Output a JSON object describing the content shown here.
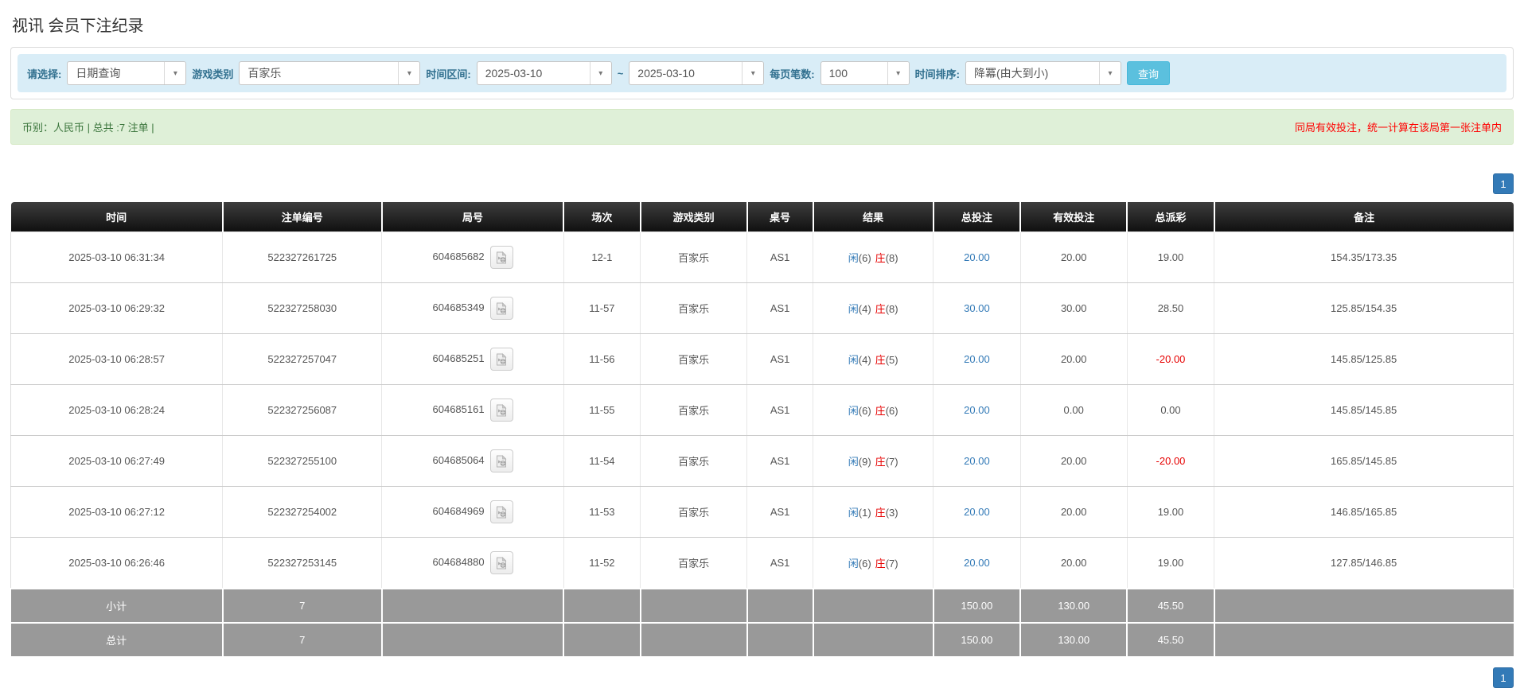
{
  "page": {
    "title": "视讯 会员下注纪录"
  },
  "filters": {
    "select_label": "请选择:",
    "query_type_value": "日期查询",
    "game_type_label": "游戏类别",
    "game_type_value": "百家乐",
    "date_range_label": "时间区间:",
    "date_from": "2025-03-10",
    "range_separator": "~",
    "date_to": "2025-03-10",
    "page_size_label": "每页笔数:",
    "page_size_value": "100",
    "sort_label": "时间排序:",
    "sort_value": "降冪(由大到小)",
    "search_button": "查询"
  },
  "summary": {
    "left_text": "币别：人民币 | 总共 :7 注单 |",
    "notice": "同局有效投注，统一计算在该局第一张注单内"
  },
  "pagination": {
    "active_page": "1"
  },
  "icons": {
    "dropdown_arrow": "▾",
    "video_replay_icon": "film-document-icon"
  },
  "colors": {
    "filter_bar_bg": "#d9edf7",
    "filter_label": "#31708f",
    "search_button": "#5bc0de",
    "summary_bg": "#dff0d8",
    "summary_text": "#3c763d",
    "notice_red": "#ff0000",
    "header_bg": "#1b1b1b",
    "footer_bg": "#999999",
    "link_blue": "#337ab7",
    "player_blue": "#337ab7",
    "banker_red": "#e60000",
    "negative_red": "#e60000",
    "pagination_active": "#337ab7"
  },
  "table": {
    "columns": [
      "时间",
      "注单编号",
      "局号",
      "场次",
      "游戏类别",
      "桌号",
      "结果",
      "总投注",
      "有效投注",
      "总派彩",
      "备注"
    ],
    "rows": [
      {
        "time": "2025-03-10 06:31:34",
        "bet_id": "522327261725",
        "round_id": "604685682",
        "session": "12-1",
        "game": "百家乐",
        "table_no": "AS1",
        "player": "闲",
        "player_score": "(6)",
        "banker": "庄",
        "banker_score": "(8)",
        "total_bet": "20.00",
        "valid_bet": "20.00",
        "payout": "19.00",
        "note": "154.35/173.35"
      },
      {
        "time": "2025-03-10 06:29:32",
        "bet_id": "522327258030",
        "round_id": "604685349",
        "session": "11-57",
        "game": "百家乐",
        "table_no": "AS1",
        "player": "闲",
        "player_score": "(4)",
        "banker": "庄",
        "banker_score": "(8)",
        "total_bet": "30.00",
        "valid_bet": "30.00",
        "payout": "28.50",
        "note": "125.85/154.35"
      },
      {
        "time": "2025-03-10 06:28:57",
        "bet_id": "522327257047",
        "round_id": "604685251",
        "session": "11-56",
        "game": "百家乐",
        "table_no": "AS1",
        "player": "闲",
        "player_score": "(4)",
        "banker": "庄",
        "banker_score": "(5)",
        "total_bet": "20.00",
        "valid_bet": "20.00",
        "payout": "-20.00",
        "note": "145.85/125.85"
      },
      {
        "time": "2025-03-10 06:28:24",
        "bet_id": "522327256087",
        "round_id": "604685161",
        "session": "11-55",
        "game": "百家乐",
        "table_no": "AS1",
        "player": "闲",
        "player_score": "(6)",
        "banker": "庄",
        "banker_score": "(6)",
        "total_bet": "20.00",
        "valid_bet": "0.00",
        "payout": "0.00",
        "note": "145.85/145.85"
      },
      {
        "time": "2025-03-10 06:27:49",
        "bet_id": "522327255100",
        "round_id": "604685064",
        "session": "11-54",
        "game": "百家乐",
        "table_no": "AS1",
        "player": "闲",
        "player_score": "(9)",
        "banker": "庄",
        "banker_score": "(7)",
        "total_bet": "20.00",
        "valid_bet": "20.00",
        "payout": "-20.00",
        "note": "165.85/145.85"
      },
      {
        "time": "2025-03-10 06:27:12",
        "bet_id": "522327254002",
        "round_id": "604684969",
        "session": "11-53",
        "game": "百家乐",
        "table_no": "AS1",
        "player": "闲",
        "player_score": "(1)",
        "banker": "庄",
        "banker_score": "(3)",
        "total_bet": "20.00",
        "valid_bet": "20.00",
        "payout": "19.00",
        "note": "146.85/165.85"
      },
      {
        "time": "2025-03-10 06:26:46",
        "bet_id": "522327253145",
        "round_id": "604684880",
        "session": "11-52",
        "game": "百家乐",
        "table_no": "AS1",
        "player": "闲",
        "player_score": "(6)",
        "banker": "庄",
        "banker_score": "(7)",
        "total_bet": "20.00",
        "valid_bet": "20.00",
        "payout": "19.00",
        "note": "127.85/146.85"
      }
    ],
    "subtotal": {
      "label": "小计",
      "count": "7",
      "total_bet": "150.00",
      "valid_bet": "130.00",
      "payout": "45.50"
    },
    "total": {
      "label": "总计",
      "count": "7",
      "total_bet": "150.00",
      "valid_bet": "130.00",
      "payout": "45.50"
    }
  }
}
